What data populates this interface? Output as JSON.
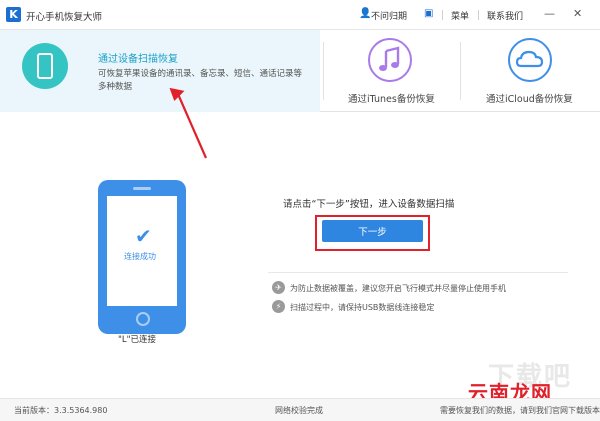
{
  "titlebar": {
    "app_title": "开心手机恢复大师",
    "logo_letter": "K",
    "user_label": "不问归期",
    "menu_label": "菜单",
    "contact_label": "联系我们",
    "minimize": "—",
    "close": "✕"
  },
  "modes": {
    "device": {
      "title": "通过设备扫描恢复",
      "description": "可恢复苹果设备的通讯录、备忘录、短信、通话记录等多种数据"
    },
    "itunes": {
      "label": "通过iTunes备份恢复",
      "icon_color": "#a97be8"
    },
    "icloud": {
      "label": "通过iCloud备份恢复",
      "icon_color": "#3d8fe8"
    }
  },
  "device": {
    "status": "连接成功",
    "label": "\"L\"已连接"
  },
  "main": {
    "instruction": "请点击“下一步”按钮，进入设备数据扫描",
    "next_button": "下一步",
    "hints": [
      "为防止数据被覆盖，建议您开启飞行模式并尽量停止使用手机",
      "扫描过程中，请保持USB数据线连接稳定"
    ]
  },
  "watermark": {
    "faint_text": "下载吧",
    "brand_text": "云南龙网"
  },
  "statusbar": {
    "version": "当前版本：3.3.5364.980",
    "network": "网络校验完成",
    "right_text": "需要恢复我们的数据，请到我们官网下载版本"
  },
  "colors": {
    "accent": "#2f86e0",
    "highlight_red": "#e0202a",
    "teal": "#34c4c4"
  }
}
